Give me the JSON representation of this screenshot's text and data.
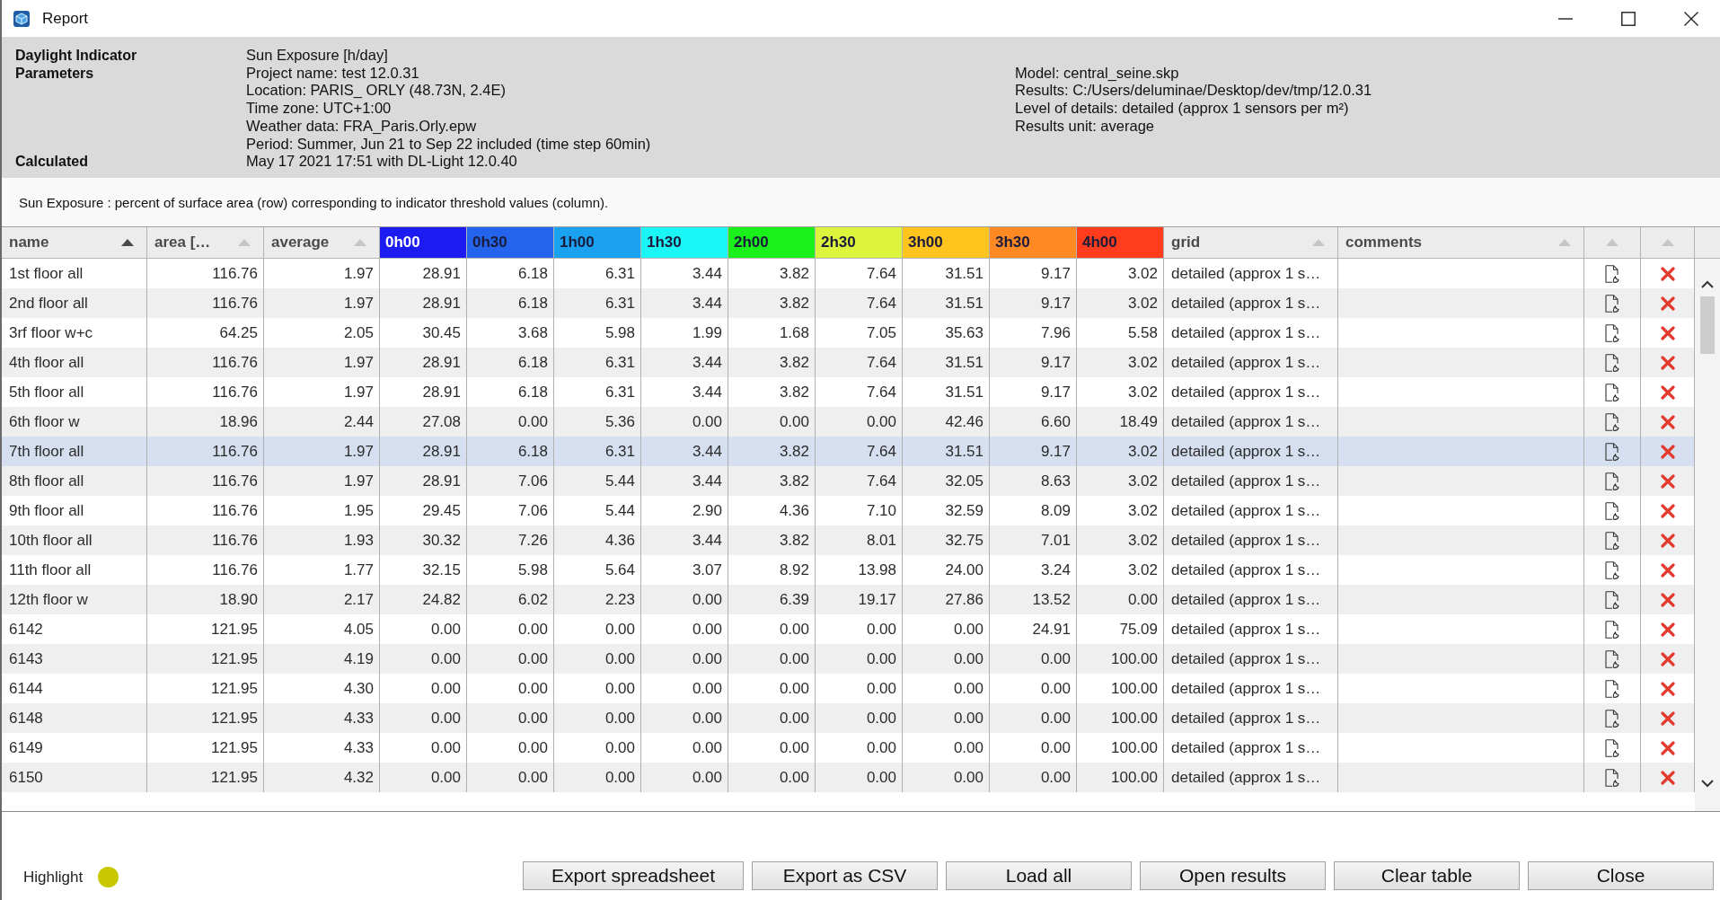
{
  "window": {
    "title": "Report"
  },
  "info": {
    "indicator_label": "Daylight Indicator Parameters",
    "parameters": [
      "Sun Exposure [h/day]",
      "Project name: test 12.0.31",
      "Location: PARIS_ ORLY (48.73N, 2.4E)",
      "Time zone: UTC+1:00",
      "Weather data: FRA_Paris.Orly.epw",
      "Period: Summer, Jun 21 to Sep 22 included (time step 60min)"
    ],
    "calculated_label": "Calculated",
    "calculated": "May 17 2021 17:51 with DL-Light 12.0.40",
    "model_details": [
      "Model: central_seine.skp",
      "Results: C:/Users/deluminae/Desktop/dev/tmp/12.0.31",
      "Level of details: detailed (approx 1 sensors per m²)",
      "Results unit: average"
    ]
  },
  "description": "Sun Exposure : percent of surface area (row) corresponding to indicator threshold values (column).",
  "table": {
    "columns": [
      {
        "label": "name",
        "kind": "sortable",
        "sorted": true
      },
      {
        "label": "area […",
        "kind": "sortable",
        "sorted": false
      },
      {
        "label": "average",
        "kind": "sortable",
        "sorted": false
      },
      {
        "label": "0h00",
        "kind": "threshold",
        "color": "#1c1cf2"
      },
      {
        "label": "0h30",
        "kind": "threshold",
        "color": "#2464ec"
      },
      {
        "label": "1h00",
        "kind": "threshold",
        "color": "#1aa2f0"
      },
      {
        "label": "1h30",
        "kind": "threshold",
        "color": "#1af5f5"
      },
      {
        "label": "2h00",
        "kind": "threshold",
        "color": "#1af01a"
      },
      {
        "label": "2h30",
        "kind": "threshold",
        "color": "#dcf53c"
      },
      {
        "label": "3h00",
        "kind": "threshold",
        "color": "#ffc41e"
      },
      {
        "label": "3h30",
        "kind": "threshold",
        "color": "#ff8a24"
      },
      {
        "label": "4h00",
        "kind": "threshold",
        "color": "#ff3c1c"
      },
      {
        "label": "grid",
        "kind": "sortable",
        "sorted": false
      },
      {
        "label": "comments",
        "kind": "sortable",
        "sorted": false
      },
      {
        "kind": "sortable",
        "sorted": false
      },
      {
        "kind": "sortable",
        "sorted": false
      }
    ],
    "rows": [
      {
        "name": "1st floor all",
        "area": "116.76",
        "average": "1.97",
        "values": [
          "28.91",
          "6.18",
          "6.31",
          "3.44",
          "3.82",
          "7.64",
          "31.51",
          "9.17",
          "3.02"
        ],
        "grid": "detailed (approx 1 s…",
        "selected": false
      },
      {
        "name": "2nd floor all",
        "area": "116.76",
        "average": "1.97",
        "values": [
          "28.91",
          "6.18",
          "6.31",
          "3.44",
          "3.82",
          "7.64",
          "31.51",
          "9.17",
          "3.02"
        ],
        "grid": "detailed (approx 1 s…",
        "selected": false
      },
      {
        "name": "3rf floor w+c",
        "area": "64.25",
        "average": "2.05",
        "values": [
          "30.45",
          "3.68",
          "5.98",
          "1.99",
          "1.68",
          "7.05",
          "35.63",
          "7.96",
          "5.58"
        ],
        "grid": "detailed (approx 1 s…",
        "selected": false
      },
      {
        "name": "4th floor all",
        "area": "116.76",
        "average": "1.97",
        "values": [
          "28.91",
          "6.18",
          "6.31",
          "3.44",
          "3.82",
          "7.64",
          "31.51",
          "9.17",
          "3.02"
        ],
        "grid": "detailed (approx 1 s…",
        "selected": false
      },
      {
        "name": "5th floor all",
        "area": "116.76",
        "average": "1.97",
        "values": [
          "28.91",
          "6.18",
          "6.31",
          "3.44",
          "3.82",
          "7.64",
          "31.51",
          "9.17",
          "3.02"
        ],
        "grid": "detailed (approx 1 s…",
        "selected": false
      },
      {
        "name": "6th floor w",
        "area": "18.96",
        "average": "2.44",
        "values": [
          "27.08",
          "0.00",
          "5.36",
          "0.00",
          "0.00",
          "0.00",
          "42.46",
          "6.60",
          "18.49"
        ],
        "grid": "detailed (approx 1 s…",
        "selected": false
      },
      {
        "name": "7th floor all",
        "area": "116.76",
        "average": "1.97",
        "values": [
          "28.91",
          "6.18",
          "6.31",
          "3.44",
          "3.82",
          "7.64",
          "31.51",
          "9.17",
          "3.02"
        ],
        "grid": "detailed (approx 1 s…",
        "selected": true
      },
      {
        "name": "8th floor all",
        "area": "116.76",
        "average": "1.97",
        "values": [
          "28.91",
          "7.06",
          "5.44",
          "3.44",
          "3.82",
          "7.64",
          "32.05",
          "8.63",
          "3.02"
        ],
        "grid": "detailed (approx 1 s…",
        "selected": false
      },
      {
        "name": "9th floor all",
        "area": "116.76",
        "average": "1.95",
        "values": [
          "29.45",
          "7.06",
          "5.44",
          "2.90",
          "4.36",
          "7.10",
          "32.59",
          "8.09",
          "3.02"
        ],
        "grid": "detailed (approx 1 s…",
        "selected": false
      },
      {
        "name": "10th floor all",
        "area": "116.76",
        "average": "1.93",
        "values": [
          "30.32",
          "7.26",
          "4.36",
          "3.44",
          "3.82",
          "8.01",
          "32.75",
          "7.01",
          "3.02"
        ],
        "grid": "detailed (approx 1 s…",
        "selected": false
      },
      {
        "name": "11th floor all",
        "area": "116.76",
        "average": "1.77",
        "values": [
          "32.15",
          "5.98",
          "5.64",
          "3.07",
          "8.92",
          "13.98",
          "24.00",
          "3.24",
          "3.02"
        ],
        "grid": "detailed (approx 1 s…",
        "selected": false
      },
      {
        "name": "12th floor w",
        "area": "18.90",
        "average": "2.17",
        "values": [
          "24.82",
          "6.02",
          "2.23",
          "0.00",
          "6.39",
          "19.17",
          "27.86",
          "13.52",
          "0.00"
        ],
        "grid": "detailed (approx 1 s…",
        "selected": false
      },
      {
        "name": "6142",
        "area": "121.95",
        "average": "4.05",
        "values": [
          "0.00",
          "0.00",
          "0.00",
          "0.00",
          "0.00",
          "0.00",
          "0.00",
          "24.91",
          "75.09"
        ],
        "grid": "detailed (approx 1 s…",
        "selected": false
      },
      {
        "name": "6143",
        "area": "121.95",
        "average": "4.19",
        "values": [
          "0.00",
          "0.00",
          "0.00",
          "0.00",
          "0.00",
          "0.00",
          "0.00",
          "0.00",
          "100.00"
        ],
        "grid": "detailed (approx 1 s…",
        "selected": false
      },
      {
        "name": "6144",
        "area": "121.95",
        "average": "4.30",
        "values": [
          "0.00",
          "0.00",
          "0.00",
          "0.00",
          "0.00",
          "0.00",
          "0.00",
          "0.00",
          "100.00"
        ],
        "grid": "detailed (approx 1 s…",
        "selected": false
      },
      {
        "name": "6148",
        "area": "121.95",
        "average": "4.33",
        "values": [
          "0.00",
          "0.00",
          "0.00",
          "0.00",
          "0.00",
          "0.00",
          "0.00",
          "0.00",
          "100.00"
        ],
        "grid": "detailed (approx 1 s…",
        "selected": false
      },
      {
        "name": "6149",
        "area": "121.95",
        "average": "4.33",
        "values": [
          "0.00",
          "0.00",
          "0.00",
          "0.00",
          "0.00",
          "0.00",
          "0.00",
          "0.00",
          "100.00"
        ],
        "grid": "detailed (approx 1 s…",
        "selected": false
      },
      {
        "name": "6150",
        "area": "121.95",
        "average": "4.32",
        "values": [
          "0.00",
          "0.00",
          "0.00",
          "0.00",
          "0.00",
          "0.00",
          "0.00",
          "0.00",
          "100.00"
        ],
        "grid": "detailed (approx 1 s…",
        "selected": false
      }
    ]
  },
  "highlight": {
    "label": "Highlight",
    "color": "#c8c800"
  },
  "buttons": [
    "Export spreadsheet",
    "Export as CSV",
    "Load all",
    "Open results",
    "Clear table",
    "Close"
  ]
}
